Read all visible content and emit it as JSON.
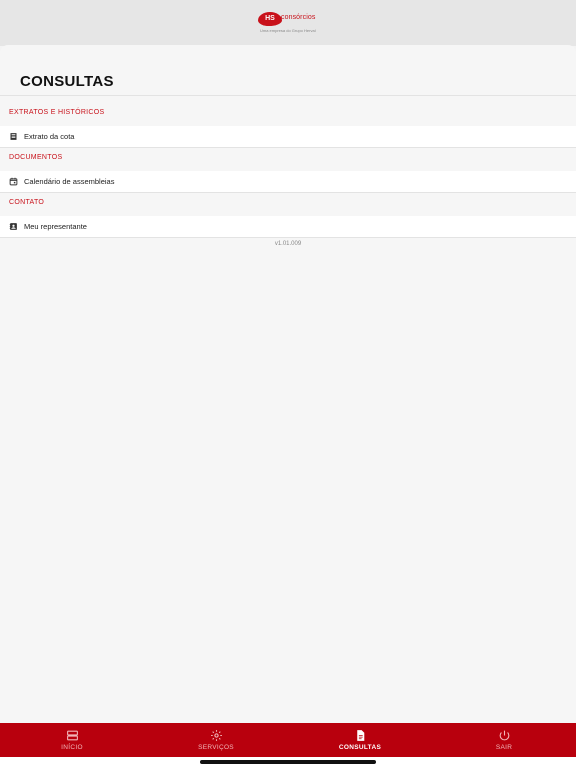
{
  "brand": {
    "mark": "HS",
    "word": "consórcios",
    "tagline": "Uma empresa do Grupo Herval",
    "color": "#c8111a"
  },
  "page": {
    "title": "CONSULTAS"
  },
  "sections": [
    {
      "header": "EXTRATOS E HISTÓRICOS",
      "item": {
        "label": "Extrato da cota",
        "icon": "document-list-icon"
      }
    },
    {
      "header": "DOCUMENTOS",
      "item": {
        "label": "Calendário de assembleias",
        "icon": "calendar-icon"
      }
    },
    {
      "header": "CONTATO",
      "item": {
        "label": "Meu representante",
        "icon": "contact-card-icon"
      }
    }
  ],
  "version": "v1.01.009",
  "tabs": [
    {
      "label": "INÍCIO",
      "icon": "home-server-icon"
    },
    {
      "label": "SERVIÇOS",
      "icon": "gear-icon"
    },
    {
      "label": "CONSULTAS",
      "icon": "document-icon",
      "active": true
    },
    {
      "label": "SAIR",
      "icon": "power-icon"
    }
  ],
  "colors": {
    "accent": "#b8000d",
    "section_header": "#c8111a",
    "background": "#f6f6f6"
  }
}
